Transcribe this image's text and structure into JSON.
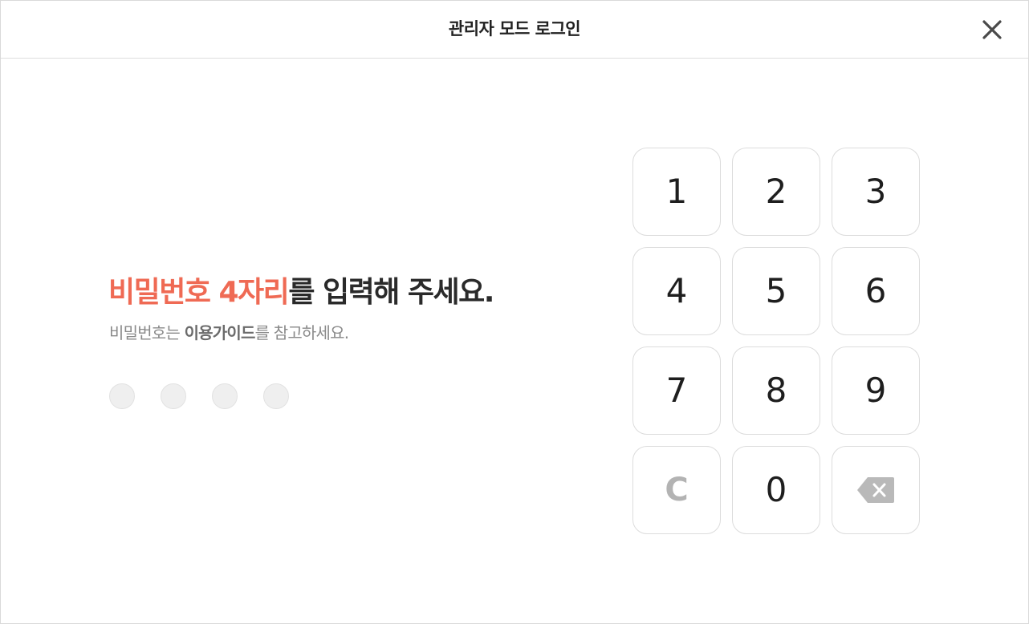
{
  "header": {
    "title": "관리자 모드 로그인",
    "close_icon": "close-icon"
  },
  "prompt": {
    "title_accent": "비밀번호 4자리",
    "title_rest": "를 입력해 주세요.",
    "subtitle_prefix": "비밀번호는 ",
    "subtitle_bold": "이용가이드",
    "subtitle_suffix": "를 참고하세요."
  },
  "pin": {
    "length": 4,
    "entered": 0
  },
  "keypad": {
    "keys": [
      "1",
      "2",
      "3",
      "4",
      "5",
      "6",
      "7",
      "8",
      "9",
      "C",
      "0"
    ],
    "backspace_icon": "backspace-icon"
  },
  "colors": {
    "accent": "#ef6a54",
    "text_dark": "#2a2a2a",
    "text_gray": "#8a8a8a",
    "dot_empty": "#efefef",
    "clear_key": "#b3b3b3",
    "backspace_fill": "#b9b9b9",
    "border": "#dcdcdc"
  }
}
